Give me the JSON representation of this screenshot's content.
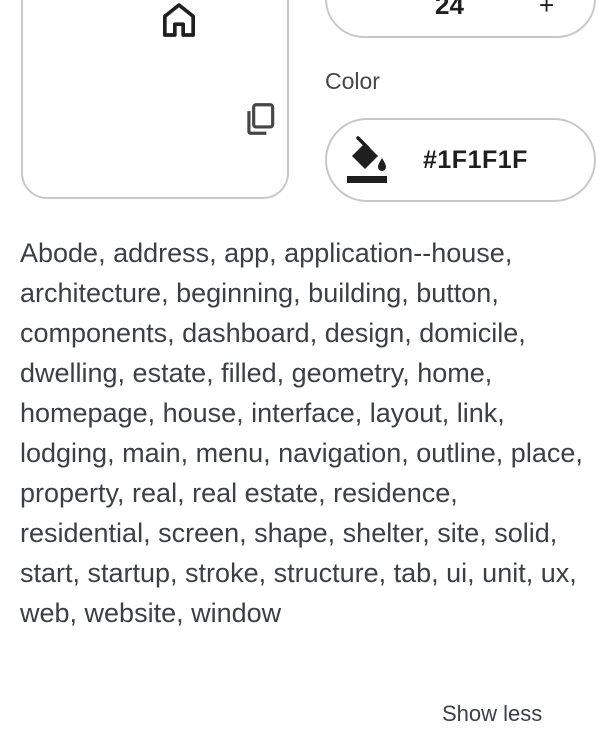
{
  "preview": {
    "main_icon": "home-icon",
    "copy_icon": "copy-icon"
  },
  "size": {
    "value": "24",
    "plus_label": "+"
  },
  "color": {
    "label": "Color",
    "value": "#1F1F1F",
    "icon": "paint-bucket-icon",
    "swatch_color": "#1F1F1F"
  },
  "tags": {
    "text": "Abode, address, app, application--house, architecture, beginning, building, button, components, dashboard, design, domicile, dwelling, estate, filled, geometry, home, homepage, house, interface, layout, link, lodging, main, menu, navigation, outline, place, property, real, real estate, residence, residential, screen, shape, shelter, site, solid, start, startup, stroke, structure, tab, ui, unit, ux, web, website, window"
  },
  "show_less_label": "Show less"
}
